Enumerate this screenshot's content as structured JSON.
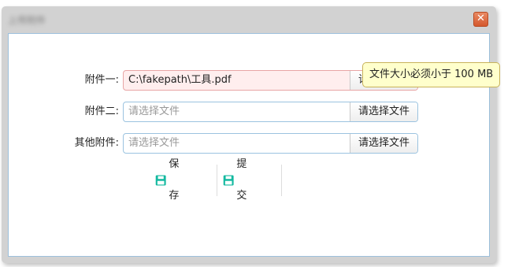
{
  "dialog": {
    "title": "上传附件",
    "close_icon": "close-icon",
    "close_glyph": "✕"
  },
  "form": {
    "attachment1": {
      "label": "附件一:",
      "value": "C:\\fakepath\\工具.pdf",
      "button": "请选择文件",
      "has_error": true
    },
    "attachment2": {
      "label": "附件二:",
      "placeholder": "请选择文件",
      "button": "请选择文件"
    },
    "attachment_other": {
      "label": "其他附件:",
      "placeholder": "请选择文件",
      "button": "请选择文件"
    }
  },
  "tooltip": {
    "text": "文件大小必须小于 100 MB"
  },
  "actions": {
    "save_label": "保存",
    "submit_label": "提交",
    "save_icon": "floppy-disk-icon",
    "submit_icon": "floppy-disk-icon"
  },
  "colors": {
    "icon_accent": "#14b9a0",
    "close_button": "#dd6a3f",
    "error_field_bg": "#ffeeee",
    "tooltip_bg": "#ffffcc"
  }
}
